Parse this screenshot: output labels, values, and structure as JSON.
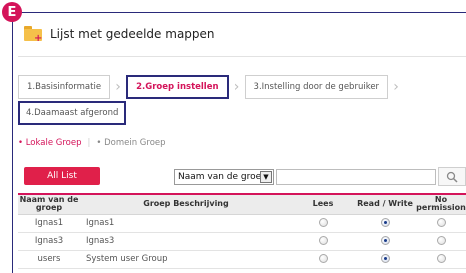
{
  "badge": "E",
  "header": {
    "title": "Lijst met gedeelde mappen"
  },
  "steps": [
    {
      "label": "1.Basisinformatie"
    },
    {
      "label": "2.Groep instellen"
    },
    {
      "label": "3.Instelling door de gebruiker"
    },
    {
      "label": "4.Daamaast afgerond"
    }
  ],
  "scope": {
    "local": "• Lokale Groep",
    "divider": "|",
    "domain": "• Domein Groep"
  },
  "toolbar": {
    "all_list": "All List",
    "select_value": "Naam van de groep"
  },
  "table": {
    "headers": {
      "name": "Naam van de groep",
      "desc": "Groep Beschrijving",
      "lees": "Lees",
      "rw": "Read / Write",
      "np": "No permission"
    },
    "rows": [
      {
        "name": "Ignas1",
        "desc": "Ignas1",
        "selected": "rw"
      },
      {
        "name": "Ignas3",
        "desc": "Ignas3",
        "selected": "rw"
      },
      {
        "name": "users",
        "desc": "System user Group",
        "selected": "rw"
      }
    ]
  },
  "colors": {
    "accent": "#d4145a",
    "button": "#e0204a",
    "highlight_border": "#2a2a7a"
  }
}
